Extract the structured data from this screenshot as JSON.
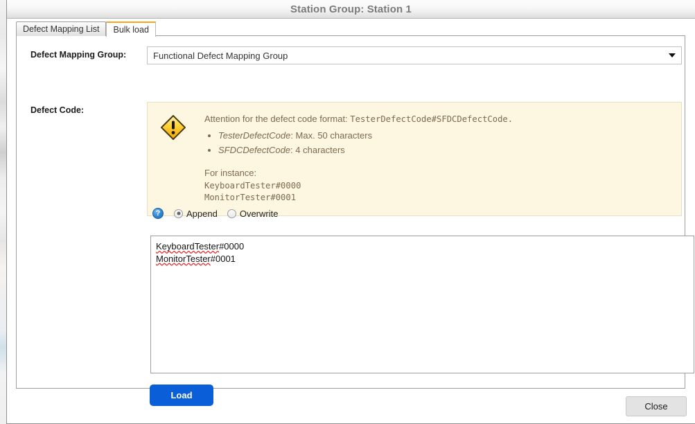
{
  "window": {
    "title": "Station Group: Station 1"
  },
  "tabs": [
    {
      "label": "Defect Mapping List",
      "active": false
    },
    {
      "label": "Bulk load",
      "active": true
    }
  ],
  "form": {
    "mapping_group_label": "Defect Mapping Group:",
    "mapping_group_value": "Functional Defect Mapping Group",
    "defect_code_label": "Defect Code:"
  },
  "attention": {
    "icon": "warning-diamond-icon",
    "intro_prefix": "Attention for the defect code format: ",
    "intro_format": "TesterDefectCode#SFDCDefectCode.",
    "bullets": [
      {
        "term": "TesterDefectCode",
        "detail": ": Max. 50 characters"
      },
      {
        "term": "SFDCDefectCode",
        "detail": ": 4 characters"
      }
    ],
    "for_instance_label": "For instance:",
    "examples": [
      "KeyboardTester#0000",
      "MonitorTester#0001"
    ]
  },
  "mode": {
    "help_icon_glyph": "?",
    "options": [
      {
        "label": "Append",
        "selected": true
      },
      {
        "label": "Overwrite",
        "selected": false
      }
    ]
  },
  "textarea": {
    "lines": [
      {
        "misspelled": "KeyboardTester",
        "rest": "#0000"
      },
      {
        "misspelled": "MonitorTester",
        "rest": "#0001"
      }
    ]
  },
  "buttons": {
    "load_label": "Load",
    "close_label": "Close"
  },
  "colors": {
    "accent_blue": "#0a5ed7",
    "tab_active_top": "#f5a623",
    "attention_bg": "#fdf6e0",
    "attention_text": "#7d6a4f",
    "title_text": "#7a7a7a"
  }
}
